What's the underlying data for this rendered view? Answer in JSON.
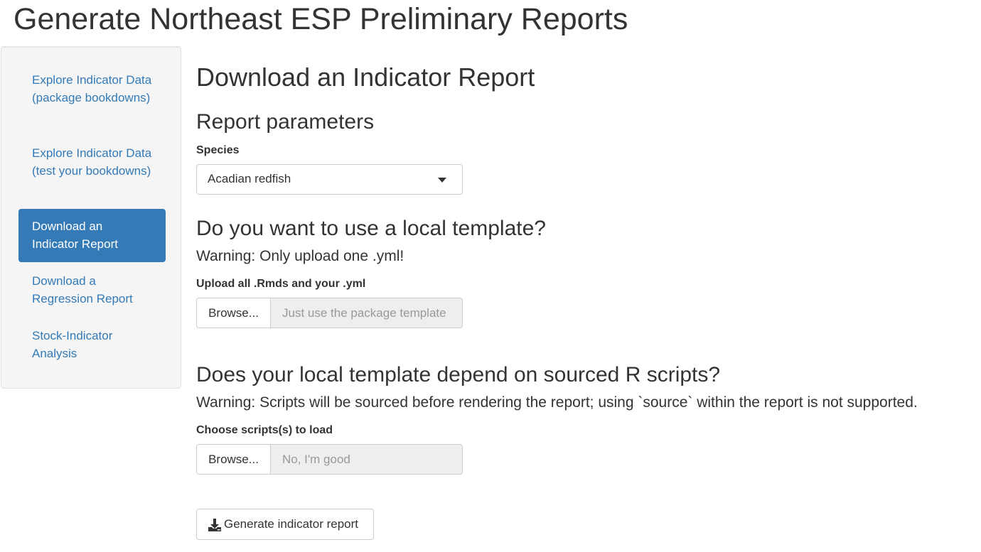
{
  "app": {
    "title": "Generate Northeast ESP Preliminary Reports"
  },
  "sidebar": {
    "items": [
      {
        "label": "Explore Indicator Data (package bookdowns)",
        "active": false
      },
      {
        "label": "Explore Indicator Data (test your bookdowns)",
        "active": false
      },
      {
        "label": "Download an Indicator Report",
        "active": true
      },
      {
        "label": "Download a Regression Report",
        "active": false
      },
      {
        "label": "Stock-Indicator Analysis",
        "active": false
      }
    ]
  },
  "main": {
    "page_title": "Download an Indicator Report",
    "parameters_heading": "Report parameters",
    "species": {
      "label": "Species",
      "selected": "Acadian redfish"
    },
    "template_section": {
      "heading": "Do you want to use a local template?",
      "warning": "Warning: Only upload one .yml!",
      "upload_label": "Upload all .Rmds and your .yml",
      "browse_label": "Browse...",
      "placeholder": "Just use the package template"
    },
    "scripts_section": {
      "heading": "Does your local template depend on sourced R scripts?",
      "warning": "Warning: Scripts will be sourced before rendering the report; using `source` within the report is not supported.",
      "upload_label": "Choose scripts(s) to load",
      "browse_label": "Browse...",
      "placeholder": "No, I'm good"
    },
    "generate_button": {
      "label": "Generate indicator report",
      "icon": "download-icon"
    }
  },
  "colors": {
    "accent": "#337ab7",
    "text": "#333333",
    "sidebar_bg": "#f5f5f5",
    "disabled_bg": "#eeeeee"
  }
}
